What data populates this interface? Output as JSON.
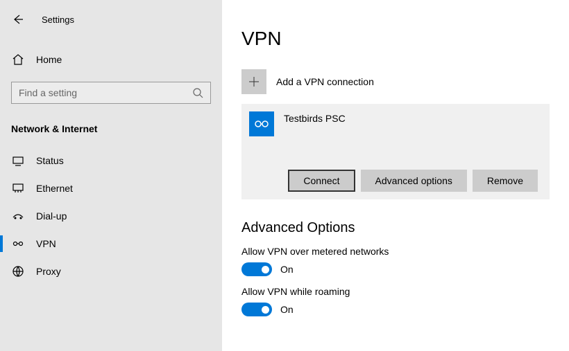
{
  "header": {
    "title": "Settings"
  },
  "home_label": "Home",
  "search": {
    "placeholder": "Find a setting"
  },
  "category": "Network & Internet",
  "nav": [
    {
      "label": "Status"
    },
    {
      "label": "Ethernet"
    },
    {
      "label": "Dial-up"
    },
    {
      "label": "VPN"
    },
    {
      "label": "Proxy"
    }
  ],
  "page": {
    "title": "VPN",
    "add_label": "Add a VPN connection",
    "vpn": {
      "name": "Testbirds PSC",
      "connect": "Connect",
      "advanced": "Advanced options",
      "remove": "Remove"
    },
    "advanced_section": {
      "title": "Advanced Options",
      "metered_label": "Allow VPN over metered networks",
      "metered_state": "On",
      "roaming_label": "Allow VPN while roaming",
      "roaming_state": "On"
    }
  }
}
